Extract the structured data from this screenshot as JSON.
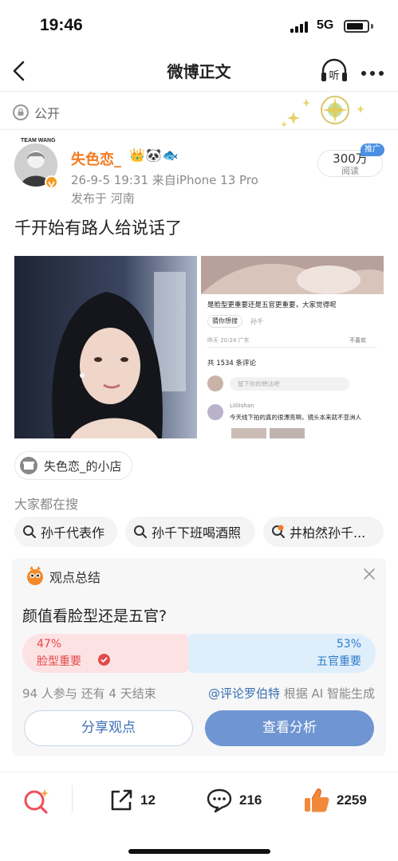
{
  "status_bar": {
    "time": "19:46",
    "network": "5G",
    "battery_level": 0.85
  },
  "nav": {
    "title": "微博正文",
    "back_icon": "chevron-left-icon",
    "listen_label": "听",
    "more_icon": "more-dots-icon"
  },
  "visibility": {
    "label": "公开",
    "icon": "lock-circle-icon"
  },
  "author": {
    "avatar_caption": "TEAM WANG",
    "name": "失色恋_",
    "emojis": "👑🐼🐟",
    "timestamp_source": "26-9-5 19:31  来自iPhone 13 Pro",
    "location": "发布于 河南",
    "verified_icon": "verified-v-icon"
  },
  "reads": {
    "count": "300万",
    "label": "阅读",
    "promo_tag": "推广"
  },
  "post": {
    "text": "千开始有路人给说话了",
    "screenshot": {
      "question": "是脸型更重要还是五官更重要，大家觉得呢",
      "guess_chip": "猜你想搜",
      "guess_term": "孙千",
      "time_loc": "昨天 20:24 广东",
      "dislike": "不喜欢",
      "comment_count": "共 1534 条评论",
      "comment_placeholder": "留下你的想法吧",
      "commenter": "Lililishan",
      "comment_text": "今天线下拍的真的很漂亮啊，镜头本来就不亚洲人"
    }
  },
  "shop": {
    "label": "失色恋_的小店",
    "icon": "shop-icon"
  },
  "search": {
    "heading": "大家都在搜",
    "chips": [
      {
        "text": "孙千代表作",
        "icon": "search-icon"
      },
      {
        "text": "孙千下班喝酒照",
        "icon": "search-icon"
      },
      {
        "text": "井柏然孙千...",
        "icon": "hot-search-icon"
      }
    ]
  },
  "opinion": {
    "title": "观点总结",
    "question": "颜值看脸型还是五官?",
    "left_pct": "47%",
    "left_label": "脸型重要",
    "left_share": 0.47,
    "right_pct": "53%",
    "right_label": "五官重要",
    "right_share": 0.53,
    "stats": "94 人参与   还有 4 天结束",
    "credit_mention": "@评论罗伯特",
    "credit_suffix": " 根据 AI 智能生成",
    "share_button": "分享观点",
    "analysis_button": "查看分析",
    "colors": {
      "left": "#fde2e3",
      "right": "#dfeefb",
      "primary": "#6f95d2"
    }
  },
  "bottom_bar": {
    "reposts": "12",
    "comments": "216",
    "likes": "2259"
  }
}
